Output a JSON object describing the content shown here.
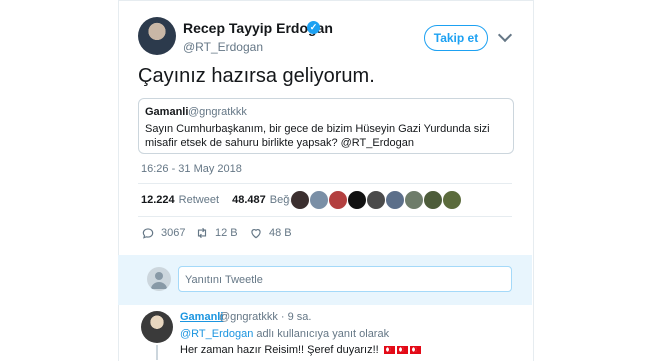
{
  "tweet": {
    "author_name": "Recep Tayyip Erdoğan",
    "author_handle": "@RT_Erdogan",
    "follow_label": "Takip et",
    "text": "Çayınız hazırsa geliyorum.",
    "timestamp": "16:26 - 31 May 2018"
  },
  "quote": {
    "name": "Gamanli",
    "handle": "@gngratkkk",
    "text": "Sayın Cumhurbaşkanım, bir gece de bizim Hüseyin Gazi Yurdunda sizi misafir etsek de sahuru birlikte yapsak? @RT_Erdogan"
  },
  "stats": {
    "retweets_count": "12.224",
    "retweets_label": "Retweet",
    "likes_count": "48.487",
    "likes_label": "Beğeni"
  },
  "likers": [
    {
      "color": "#3b2f2f"
    },
    {
      "color": "#7a8fa6"
    },
    {
      "color": "#b34040"
    },
    {
      "color": "#111111"
    },
    {
      "color": "#4a4a4a"
    },
    {
      "color": "#5c6f8a"
    },
    {
      "color": "#6e7c6a"
    },
    {
      "color": "#4d5c3a"
    },
    {
      "color": "#5b6b3c"
    }
  ],
  "actions": {
    "replies": "3067",
    "retweets": "12 B",
    "likes": "48 B"
  },
  "reply_bar": {
    "placeholder": "Yanıtını Tweetle"
  },
  "reply": {
    "name": "Gamanli",
    "handle": "@gngratkkk · 9 sa.",
    "context_mention": "@RT_Erdogan",
    "context_text": "adlı kullanıcıya yanıt olarak",
    "text": "Her zaman hazır Reisim!! Şeref duyarız!!"
  },
  "colors": {
    "accent": "#1da1f2",
    "reply_bar_bg": "#e8f5fd",
    "flag_red": "#e30a17"
  }
}
